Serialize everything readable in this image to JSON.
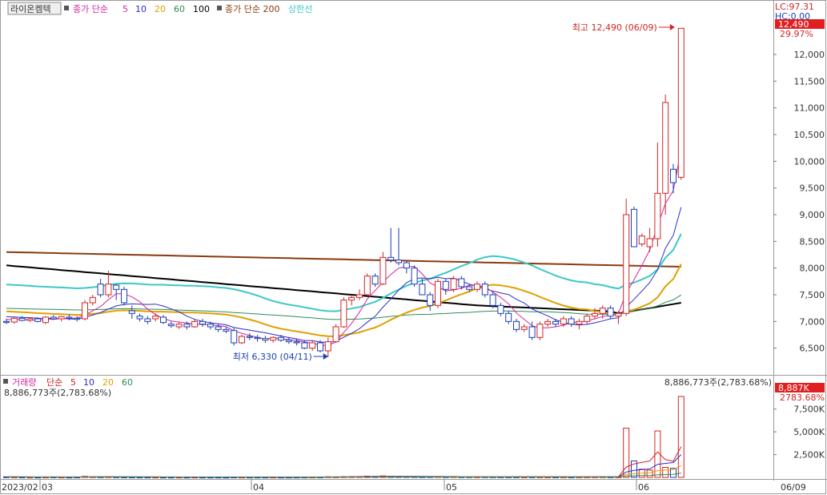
{
  "header": {
    "stock_name": "라이온켐텍",
    "ma_price_label": "종가 단순",
    "ma_periods": [
      {
        "text": "5",
        "color": "#d6249f"
      },
      {
        "text": "10",
        "color": "#2c2cc8"
      },
      {
        "text": "20",
        "color": "#e0a000"
      },
      {
        "text": "60",
        "color": "#2e8b57"
      },
      {
        "text": "100",
        "color": "#000000"
      }
    ],
    "ma_long_label": "종가 단순 200",
    "upper_limit_label": "상한선"
  },
  "price_panel": {
    "lc_label": "LC:97.31",
    "hc_label": "HC:0.00",
    "current_price": "12,490",
    "change_pct": "29.97%",
    "high_annotation": "최고 12,490 (06/09)",
    "low_annotation": "최저 6,330 (04/11)",
    "y_ticks": [
      "12,000",
      "11,500",
      "11,000",
      "10,500",
      "10,000",
      "9,500",
      "9,000",
      "8,500",
      "8,000",
      "7,500",
      "7,000",
      "6,500"
    ]
  },
  "volume_panel": {
    "title": "거래량",
    "ma_label": "단순",
    "ma_periods": [
      {
        "text": "5",
        "color": "#d62020"
      },
      {
        "text": "10",
        "color": "#2c2cc8"
      },
      {
        "text": "20",
        "color": "#e0a000"
      },
      {
        "text": "60",
        "color": "#2e8b57"
      }
    ],
    "left_value": "8,886,773주(2,783.68%)",
    "right_value": "8,886,773주(2,783.68%)",
    "current_box": "8,887K",
    "current_pct": "2783.68%",
    "y_ticks": [
      "7,500K",
      "5,000K",
      "2,500K"
    ]
  },
  "x_axis": {
    "labels": [
      "2023/02",
      "03",
      "04",
      "05",
      "06",
      "06/09"
    ]
  },
  "colors": {
    "up": "#d42424",
    "down": "#1a3fb5",
    "ma5": "#d6249f",
    "ma10": "#2c2cc8",
    "ma20": "#e0a000",
    "ma60": "#2e8b57",
    "ma100": "#000000",
    "ma200": "#8b3a0f",
    "upper": "#3cc8c8"
  },
  "chart_data": {
    "type": "candlestick",
    "y_range": [
      6300,
      12600
    ],
    "candles": [
      [
        7000,
        7050,
        6950,
        6980
      ],
      [
        6990,
        7080,
        6960,
        7060
      ],
      [
        7060,
        7100,
        7000,
        7020
      ],
      [
        7020,
        7070,
        6990,
        7050
      ],
      [
        7050,
        7080,
        6980,
        7000
      ],
      [
        6980,
        7100,
        6950,
        7080
      ],
      [
        7080,
        7120,
        7030,
        7050
      ],
      [
        7050,
        7100,
        7000,
        7090
      ],
      [
        7080,
        7130,
        7020,
        7060
      ],
      [
        7060,
        7100,
        7000,
        7040
      ],
      [
        7050,
        7400,
        7020,
        7350
      ],
      [
        7350,
        7500,
        7300,
        7450
      ],
      [
        7700,
        7800,
        7450,
        7500
      ],
      [
        7500,
        7950,
        7450,
        7700
      ],
      [
        7680,
        7700,
        7400,
        7600
      ],
      [
        7600,
        7650,
        7300,
        7350
      ],
      [
        7200,
        7300,
        7050,
        7150
      ],
      [
        7100,
        7150,
        7000,
        7050
      ],
      [
        7050,
        7100,
        6950,
        7000
      ],
      [
        7050,
        7150,
        7000,
        7100
      ],
      [
        7080,
        7120,
        6950,
        6980
      ],
      [
        6950,
        7000,
        6880,
        6920
      ],
      [
        6900,
        6980,
        6860,
        6950
      ],
      [
        6950,
        7000,
        6850,
        6900
      ],
      [
        6900,
        7050,
        6880,
        7000
      ],
      [
        7000,
        7050,
        6900,
        6950
      ],
      [
        6950,
        7000,
        6850,
        6900
      ],
      [
        6900,
        6950,
        6800,
        6850
      ],
      [
        6850,
        6900,
        6780,
        6820
      ],
      [
        6830,
        6880,
        6550,
        6600
      ],
      [
        6600,
        6750,
        6580,
        6720
      ],
      [
        6720,
        6780,
        6650,
        6700
      ],
      [
        6700,
        6750,
        6620,
        6680
      ],
      [
        6680,
        6730,
        6600,
        6650
      ],
      [
        6650,
        6720,
        6600,
        6700
      ],
      [
        6700,
        6750,
        6620,
        6650
      ],
      [
        6650,
        6700,
        6580,
        6620
      ],
      [
        6620,
        6680,
        6550,
        6600
      ],
      [
        6600,
        6650,
        6480,
        6500
      ],
      [
        6500,
        6650,
        6450,
        6600
      ],
      [
        6600,
        6650,
        6420,
        6450
      ],
      [
        6450,
        6700,
        6330,
        6620
      ],
      [
        6620,
        6950,
        6600,
        6900
      ],
      [
        6900,
        7450,
        6880,
        7400
      ],
      [
        7400,
        7500,
        7300,
        7450
      ],
      [
        7450,
        7600,
        7400,
        7500
      ],
      [
        7500,
        7900,
        7480,
        7850
      ],
      [
        7850,
        7900,
        7650,
        7700
      ],
      [
        7700,
        8300,
        7680,
        8200
      ],
      [
        8200,
        8750,
        8100,
        8150
      ],
      [
        8150,
        8750,
        8050,
        8100
      ],
      [
        8100,
        8150,
        7900,
        8000
      ],
      [
        8000,
        8050,
        7650,
        7700
      ],
      [
        7700,
        7800,
        7500,
        7500
      ],
      [
        7500,
        7550,
        7200,
        7300
      ],
      [
        7300,
        7800,
        7250,
        7750
      ],
      [
        7750,
        7800,
        7500,
        7600
      ],
      [
        7600,
        7850,
        7550,
        7800
      ],
      [
        7800,
        7850,
        7600,
        7650
      ],
      [
        7650,
        7700,
        7550,
        7600
      ],
      [
        7600,
        7750,
        7550,
        7700
      ],
      [
        7700,
        7750,
        7450,
        7500
      ],
      [
        7500,
        7550,
        7250,
        7300
      ],
      [
        7300,
        7350,
        7100,
        7150
      ],
      [
        7150,
        7200,
        6950,
        7000
      ],
      [
        7000,
        7050,
        6800,
        6850
      ],
      [
        6850,
        6950,
        6800,
        6900
      ],
      [
        6900,
        7000,
        6650,
        6700
      ],
      [
        6700,
        7000,
        6650,
        6950
      ],
      [
        6950,
        7050,
        6900,
        7000
      ],
      [
        7000,
        7050,
        6900,
        6950
      ],
      [
        6950,
        7100,
        6900,
        7050
      ],
      [
        7050,
        7100,
        6900,
        6950
      ],
      [
        6950,
        7050,
        6850,
        7000
      ],
      [
        7000,
        7150,
        6950,
        7100
      ],
      [
        7100,
        7250,
        7050,
        7150
      ],
      [
        7150,
        7300,
        7050,
        7250
      ],
      [
        7250,
        7300,
        7050,
        7100
      ],
      [
        7100,
        7200,
        6950,
        7150
      ],
      [
        7150,
        9300,
        7100,
        9000
      ],
      [
        9100,
        9150,
        8400,
        8400
      ],
      [
        8450,
        8650,
        8400,
        8600
      ],
      [
        8400,
        8750,
        8300,
        8550
      ],
      [
        8550,
        10350,
        8400,
        9400
      ],
      [
        9400,
        11250,
        9000,
        11100
      ],
      [
        9850,
        9950,
        9400,
        9600
      ],
      [
        9700,
        12490,
        9650,
        12490
      ]
    ],
    "volumes": [
      60,
      50,
      40,
      30,
      30,
      40,
      50,
      35,
      30,
      40,
      110,
      70,
      60,
      70,
      55,
      45,
      40,
      35,
      35,
      35,
      30,
      30,
      30,
      30,
      35,
      30,
      30,
      30,
      25,
      40,
      30,
      30,
      30,
      28,
      30,
      28,
      26,
      28,
      32,
      35,
      38,
      70,
      60,
      75,
      80,
      90,
      130,
      110,
      160,
      120,
      100,
      90,
      85,
      70,
      80,
      90,
      70,
      80,
      70,
      70,
      65,
      70,
      65,
      60,
      60,
      60,
      55,
      60,
      55,
      50,
      50,
      55,
      50,
      55,
      60,
      65,
      70,
      60,
      60,
      5400,
      1800,
      900,
      800,
      5100,
      1100,
      1000,
      8887
    ],
    "volume_range": [
      0,
      9500
    ]
  }
}
